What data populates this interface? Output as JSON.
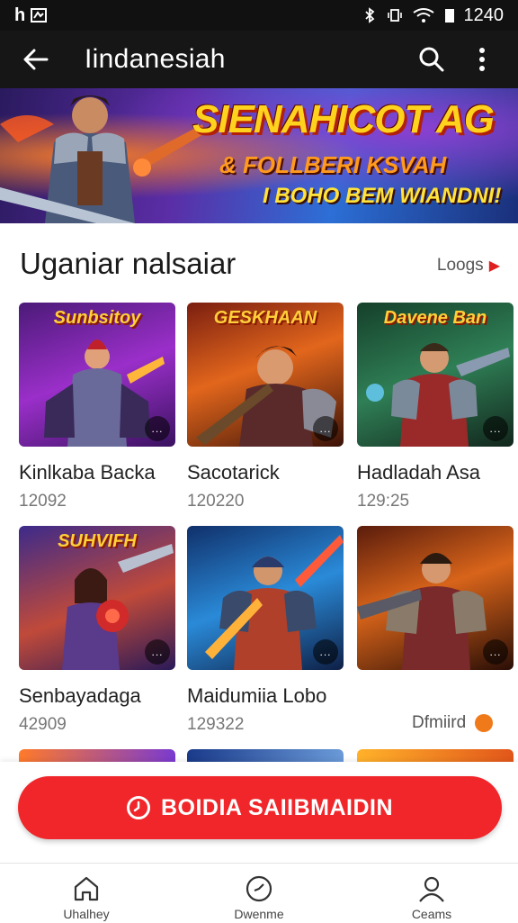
{
  "status_bar": {
    "left_label": "h",
    "time": "1240"
  },
  "app_bar": {
    "title": "Iindanesiah",
    "back_icon": "arrow-left-icon",
    "search_icon": "search-icon",
    "menu_icon": "more-vert-icon"
  },
  "banner": {
    "headline": "SIENAHICOT AG",
    "subline": "& FOLLBERI KSVAH",
    "tagline": "I BOHO BEM WIANDNI!"
  },
  "section": {
    "title": "Uganiar nalsaiar",
    "more_label": "Loogs"
  },
  "games": [
    {
      "thumb_title": "Sunbsitoy",
      "name": "Kinlkaba Backa",
      "count": "12092",
      "badge": "..."
    },
    {
      "thumb_title": "GESKHAAN",
      "name": "Sacotarick",
      "count": "120220",
      "badge": "..."
    },
    {
      "thumb_title": "Davene Ban",
      "name": "Hadladah Asa",
      "count": "129:25",
      "badge": "..."
    },
    {
      "thumb_title": "SUHVIFH",
      "name": "Senbayadaga",
      "count": "42909",
      "badge": "..."
    },
    {
      "thumb_title": "",
      "name": "Maidumiia Lobo",
      "count": "129322",
      "badge": "..."
    },
    {
      "thumb_title": "",
      "name": "",
      "count": "",
      "badge": "..."
    }
  ],
  "sponsored_label": "Dfmiird",
  "cta": {
    "label": "BOIDIA SAIIBMAIDIN"
  },
  "bottom_nav": [
    {
      "label": "Uhalhey",
      "icon": "home-icon"
    },
    {
      "label": "Dwenme",
      "icon": "compass-icon"
    },
    {
      "label": "Ceams",
      "icon": "person-icon"
    }
  ],
  "colors": {
    "accent": "#f0262a",
    "app_bar": "#161616",
    "banner_yellow": "#ffd21e"
  }
}
